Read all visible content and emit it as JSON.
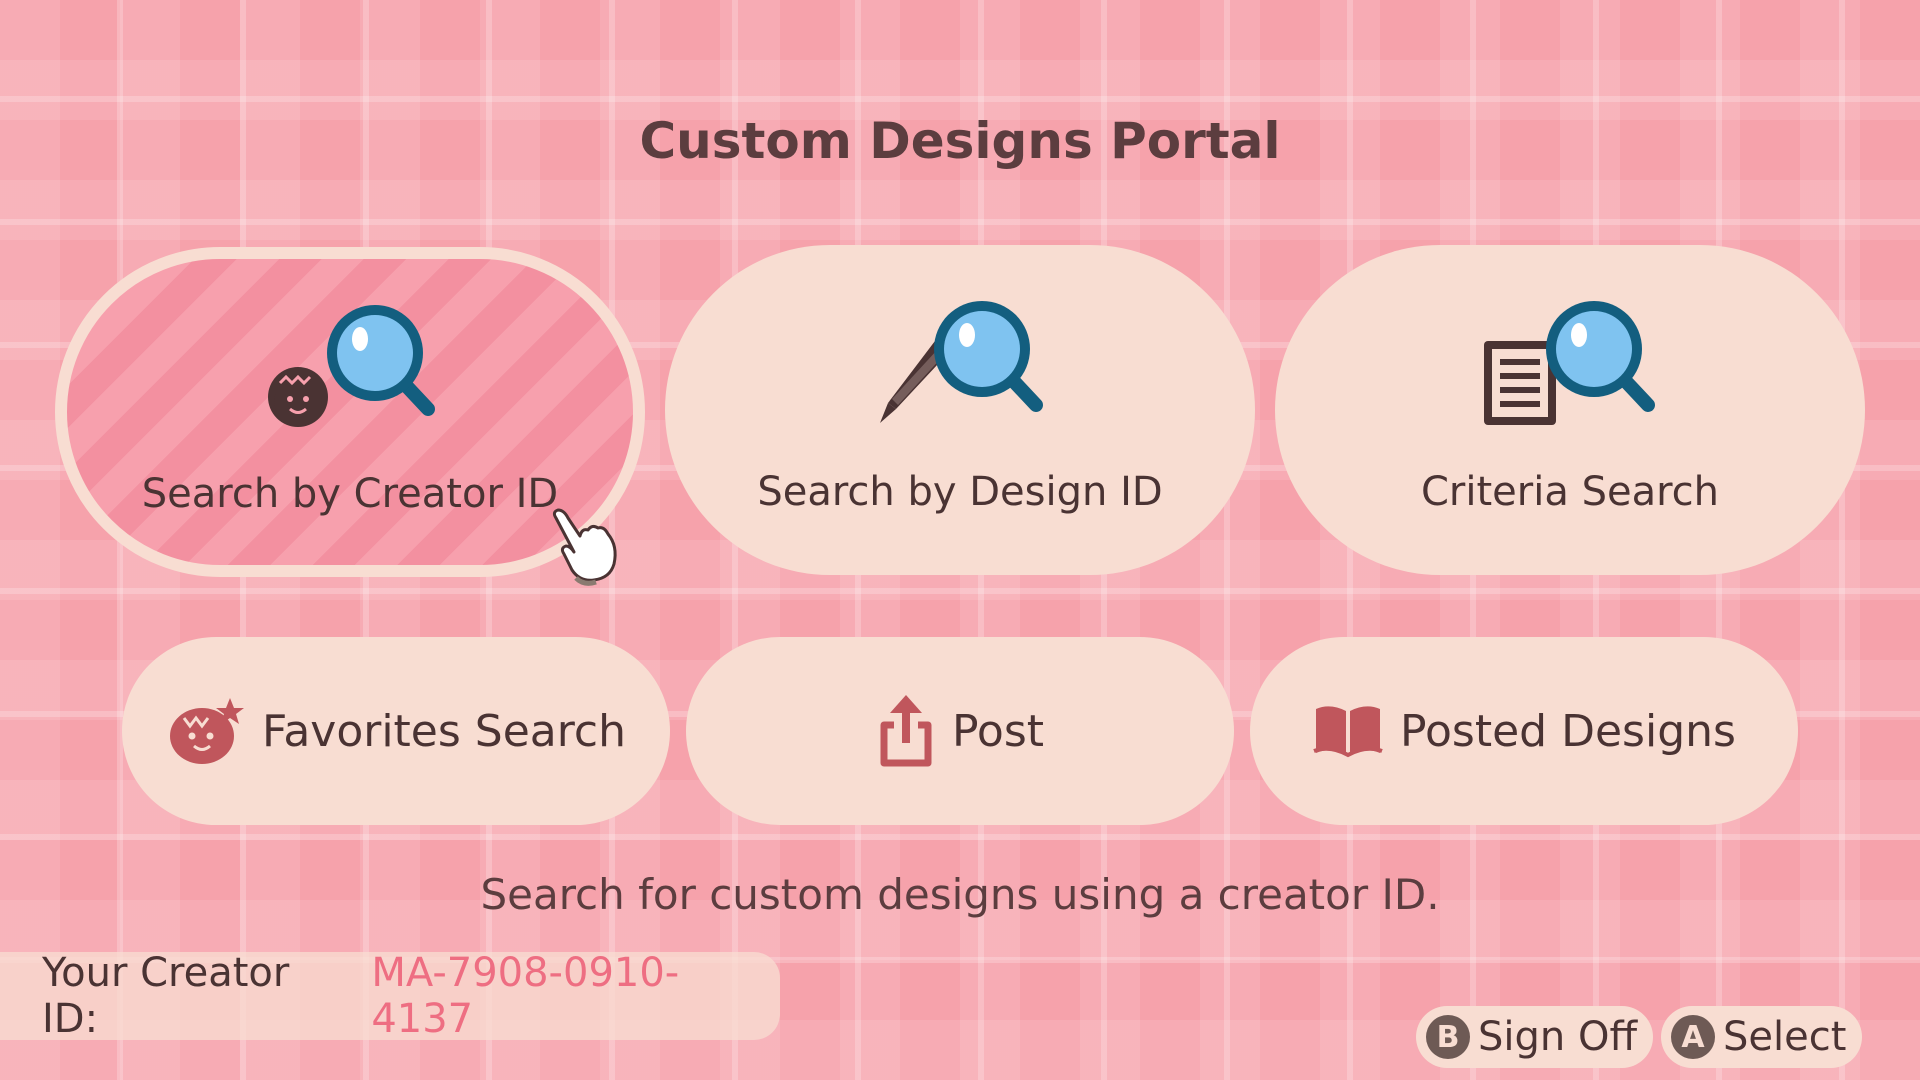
{
  "title": "Custom Designs Portal",
  "main_buttons": [
    {
      "label": "Search by Creator ID",
      "icon": "creator-search-icon",
      "selected": true
    },
    {
      "label": "Search by Design ID",
      "icon": "design-search-icon",
      "selected": false
    },
    {
      "label": "Criteria Search",
      "icon": "criteria-search-icon",
      "selected": false
    }
  ],
  "secondary_buttons": [
    {
      "label": "Favorites Search",
      "icon": "favorite-villager-icon"
    },
    {
      "label": "Post",
      "icon": "upload-icon"
    },
    {
      "label": "Posted Designs",
      "icon": "open-book-icon"
    }
  ],
  "hint": "Search for custom designs using a creator ID.",
  "creator": {
    "label": "Your Creator ID:",
    "id": "MA-7908-0910-4137"
  },
  "controls": [
    {
      "key": "B",
      "label": "Sign Off"
    },
    {
      "key": "A",
      "label": "Select"
    }
  ],
  "colors": {
    "background": "#f6a2ab",
    "button": "#f8ddd2",
    "selected_stripes": "#f390a0",
    "text": "#4a3333",
    "creator_id": "#ee6e82",
    "magnifier_lens": "#7fc3f0",
    "magnifier_ring": "#135e7f"
  }
}
